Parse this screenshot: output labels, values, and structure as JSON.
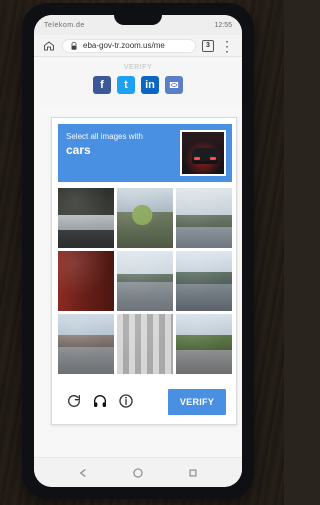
{
  "status_bar": {
    "left_text": "Telekom.de",
    "right_text": "12:55"
  },
  "browser": {
    "url": "eba-gov-tr.zoom.us/me",
    "tab_count": "3"
  },
  "page_header": {
    "verify_text": "VERIFY"
  },
  "social": {
    "facebook": "f",
    "twitter": "t",
    "linkedin": "in",
    "email": "✉"
  },
  "captcha": {
    "prompt_line1": "Select all images with",
    "prompt_line2": "cars",
    "verify_button_label": "VERIFY"
  },
  "colors": {
    "captcha_blue": "#4a90e2",
    "verify_blue": "#4a90e2",
    "browser_bg": "#f3f3f3"
  }
}
